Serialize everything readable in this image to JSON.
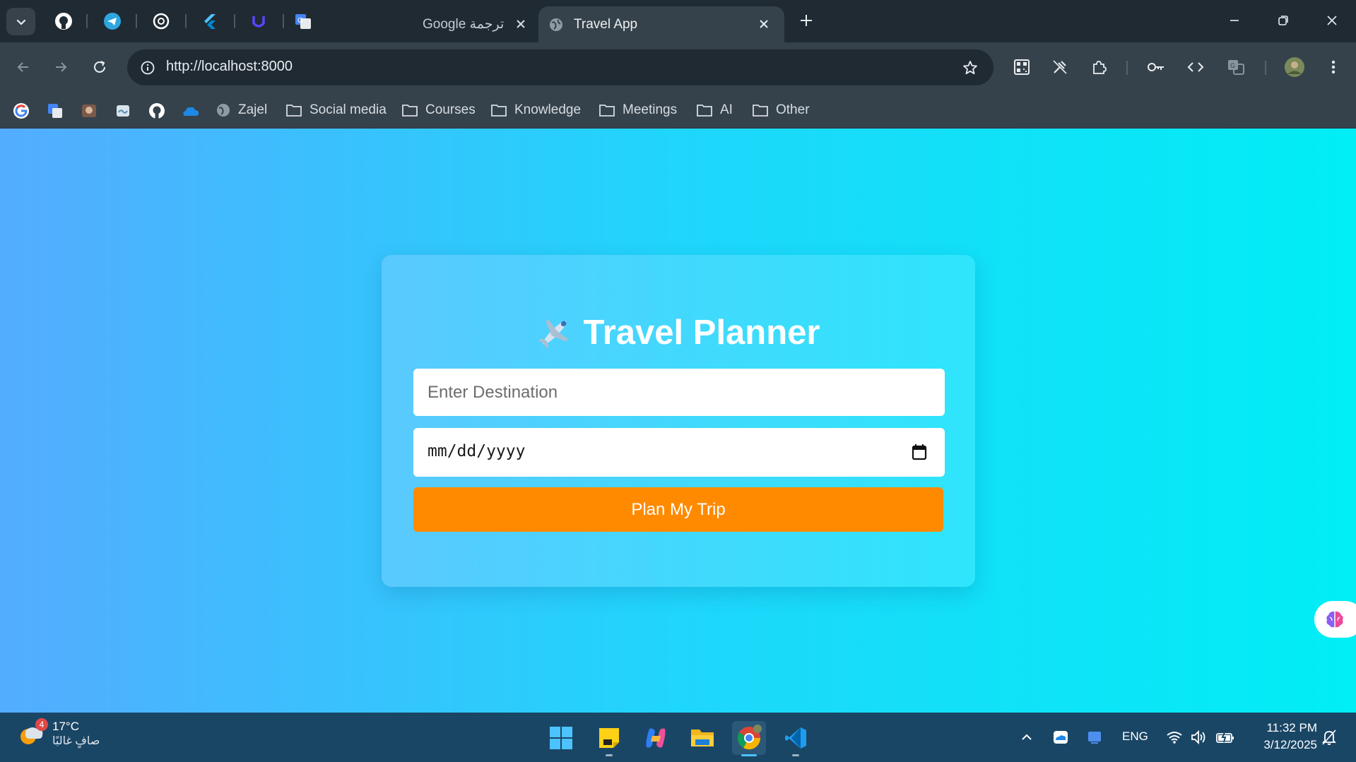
{
  "browser": {
    "tabs": [
      {
        "label": "Google ترجمة",
        "active": false
      },
      {
        "label": "Travel App",
        "active": true
      }
    ],
    "url": "http://localhost:8000",
    "bookmarks": [
      "Zajel",
      "Social media",
      "Courses",
      "Knowledge",
      "Meetings",
      "AI",
      "Other"
    ]
  },
  "app": {
    "title": "Travel Planner",
    "title_emoji": "✈️",
    "destination_placeholder": "Enter Destination",
    "date_placeholder": "mm/dd/yyyy",
    "button_label": "Plan My Trip",
    "colors": {
      "button": "#ff8a00",
      "background_start": "#54acff",
      "background_end": "#00eef5"
    }
  },
  "taskbar": {
    "weather_temp": "17°C",
    "weather_desc": "صافٍ غالبًا",
    "weather_badge": "4",
    "language": "ENG",
    "time": "11:32 PM",
    "date": "3/12/2025"
  }
}
